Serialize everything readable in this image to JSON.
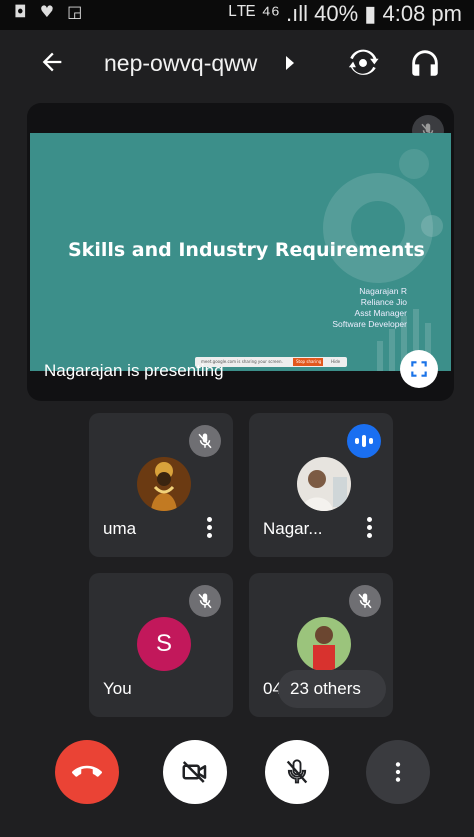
{
  "status_bar": {
    "left_icons": "◘ ♥ ◲",
    "right_text": "ᴸᵀᴱ ⁴⁶ .ıll 40% ▮ 4:08 pm"
  },
  "header": {
    "meeting_code": "nep-owvq-qww"
  },
  "presentation": {
    "slide_title": "Skills and Industry Requirements",
    "slide_info": [
      "Nagarajan R",
      "Reliance Jio",
      "Asst Manager",
      "Software Developer"
    ],
    "share_bar_text": "meet.google.com is sharing your screen.",
    "share_stop_label": "Stop sharing",
    "share_hide_label": "Hide",
    "presenting_label": "Nagarajan is presenting"
  },
  "participants": [
    {
      "name": "uma",
      "avatar": "deity-photo",
      "state": "muted"
    },
    {
      "name": "Nagar...",
      "avatar": "person-photo",
      "state": "speaking"
    },
    {
      "name": "You",
      "avatar_letter": "S",
      "avatar_color": "#c2185b",
      "state": "muted"
    },
    {
      "name": "04",
      "avatar": "child-photo",
      "state": "muted"
    }
  ],
  "others_label": "23 others",
  "controls": [
    "end-call",
    "camera-off",
    "mic-off",
    "more-options"
  ],
  "colors": {
    "end_call": "#ea4335",
    "speaking": "#1a6ff1",
    "slide_bg": "#3c8f8a",
    "tile_bg": "#2d2e31"
  }
}
